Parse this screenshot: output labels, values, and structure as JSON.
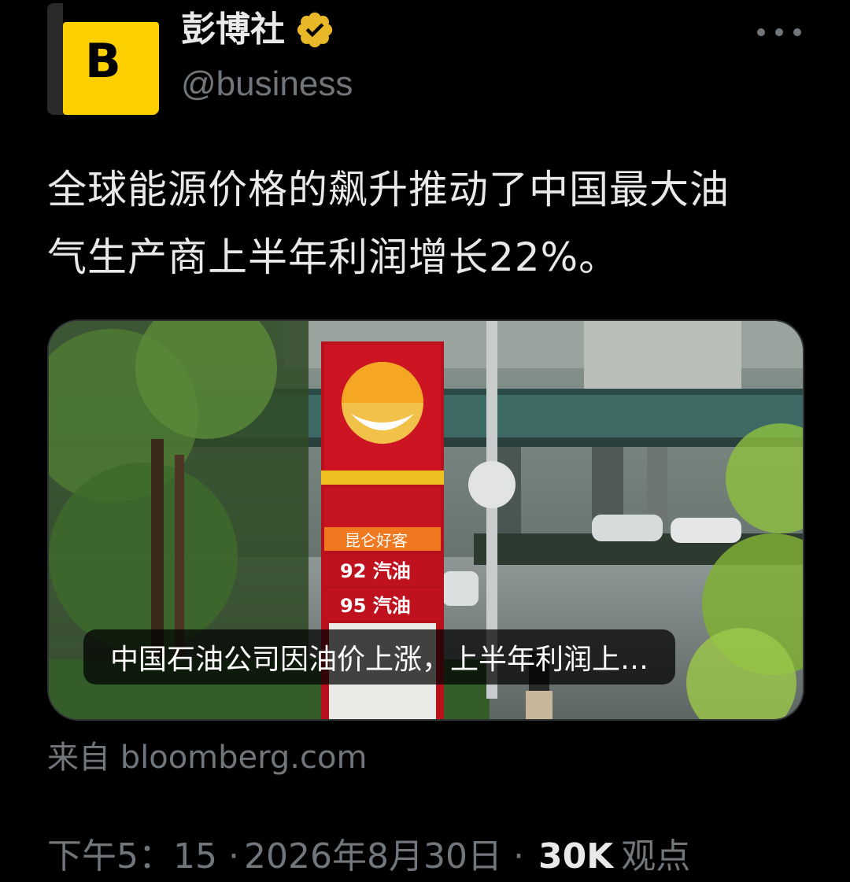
{
  "author": {
    "avatar_letter": "B",
    "display_name": "彭博社",
    "handle": "@business",
    "verified_icon": "gold-verified-badge",
    "avatar_color": "#ffd000"
  },
  "tweet": {
    "text_line1": "全球能源价格的飙升推动了中国最大油",
    "text_line2": "气生产商上半年利润增长22%。"
  },
  "card": {
    "caption": "中国石油公司因油价上涨，上半年利润上…",
    "source": "来自 bloomberg.com",
    "sign_labels": {
      "brand": "昆仑好客",
      "fuel_92": "92 汽油",
      "fuel_95": "95 汽油"
    }
  },
  "meta": {
    "time": "下午5：15",
    "separator": "·",
    "date": "2026年8月30日",
    "separator2": "·",
    "views_count": "30K",
    "views_label": "观点"
  },
  "colors": {
    "background": "#000000",
    "text_primary": "#e7e9ea",
    "text_secondary": "#71767b",
    "verified_gold": "#e8b828"
  }
}
